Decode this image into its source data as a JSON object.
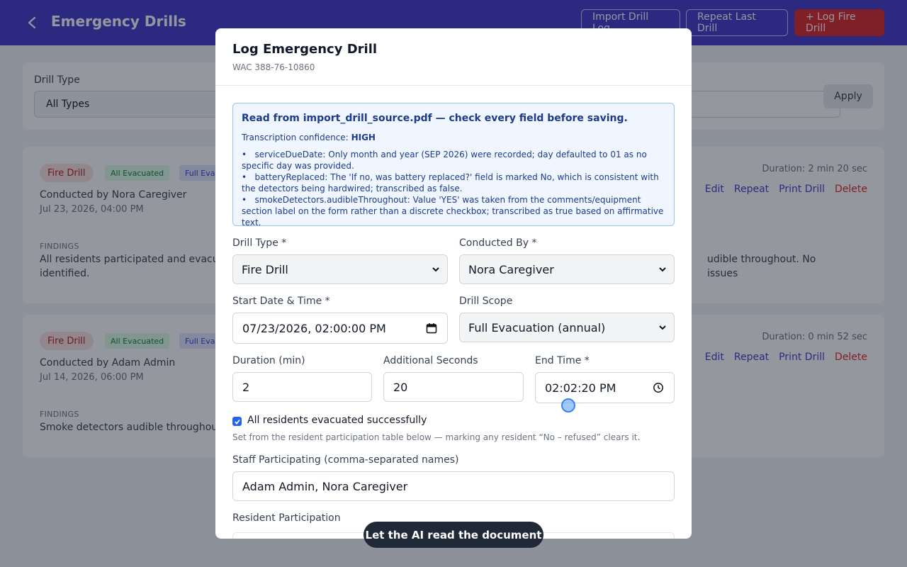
{
  "header": {
    "title": "Emergency Drills",
    "import_label": "Import Drill Log",
    "repeat_label": "Repeat Last Drill",
    "log_label": "+ Log Fire Drill"
  },
  "filter": {
    "label": "Drill Type",
    "value": "All Types",
    "apply_label": "Apply"
  },
  "drills": [
    {
      "type": "Fire Drill",
      "evac": "All Evacuated",
      "scope": "Full Evac",
      "conducted": "Conducted by Nora Caregiver",
      "date": "Jul 23, 2026, 04:00 PM",
      "duration": "Duration: 2 min 20 sec",
      "findings_label": "FINDINGS",
      "findings": "All residents participated and evacuat",
      "findings_right": "udible throughout. No issues",
      "findings_line2": "identified."
    },
    {
      "type": "Fire Drill",
      "evac": "All Evacuated",
      "scope": "Full Evac",
      "conducted": "Conducted by Adam Admin",
      "date": "Jul 14, 2026, 06:00 PM",
      "duration": "Duration: 0 min 52 sec",
      "findings_label": "FINDINGS",
      "findings": "Smoke detectors audible throughout."
    }
  ],
  "actions": {
    "edit": "Edit",
    "repeat": "Repeat",
    "print": "Print Drill",
    "delete": "Delete"
  },
  "modal": {
    "title": "Log Emergency Drill",
    "subtitle": "WAC 388-76-10860",
    "notice": {
      "headline": "Read from import_drill_source.pdf — check every field before saving.",
      "confidence_label": "Transcription confidence:",
      "confidence_value": "HIGH",
      "items": [
        "serviceDueDate: Only month and year (SEP 2026) were recorded; day defaulted to 01 as no specific day was provided.",
        "batteryReplaced: The 'If no, was battery replaced?' field is marked No, which is consistent with the detectors being hardwired; transcribed as false.",
        "smokeDetectors.audibleThroughout: Value 'YES' was taken from the comments/equipment section label on the form rather than a discrete checkbox; transcribed as true based on affirmative text."
      ]
    },
    "fields": {
      "drill_type_label": "Drill Type *",
      "drill_type_value": "Fire Drill",
      "conducted_label": "Conducted By *",
      "conducted_value": "Nora Caregiver",
      "start_label": "Start Date & Time *",
      "start_value": "07/23/2026, 02:00:00 PM",
      "scope_label": "Drill Scope",
      "scope_value": "Full Evacuation (annual)",
      "duration_label": "Duration (min)",
      "duration_value": "2",
      "seconds_label": "Additional Seconds",
      "seconds_value": "20",
      "end_label": "End Time *",
      "end_value": "02:02:20 PM",
      "evac_label": "All residents evacuated successfully",
      "evac_hint": "Set from the resident participation table below — marking any resident “No – refused” clears it.",
      "staff_label": "Staff Participating (comma-separated names)",
      "staff_value": "Adam Admin, Nora Caregiver",
      "resident_label": "Resident Participation"
    }
  },
  "toast": "Let the AI read the document"
}
